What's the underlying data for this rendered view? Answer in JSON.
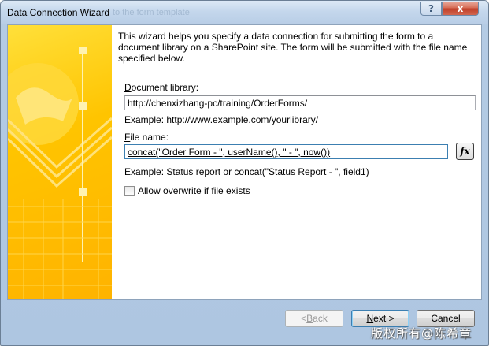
{
  "window": {
    "title": "Data Connection Wizard",
    "title_ghost": "to the form template",
    "help_label": "?",
    "close_label": "x"
  },
  "wizard": {
    "intro": "This wizard helps you specify a data connection for submitting the form to a document library on a SharePoint site. The form will be submitted with the file name specified below.",
    "library": {
      "label_access": "D",
      "label_rest": "ocument library:",
      "value": "http://chenxizhang-pc/training/OrderForms/",
      "example": "Example: http://www.example.com/yourlibrary/"
    },
    "filename": {
      "label_access": "F",
      "label_rest": "ile name:",
      "value": "concat(\"Order Form - \", userName(), \" - \", now())",
      "example": "Example: Status report or concat(\"Status Report - \", field1)",
      "function_button": "fx"
    },
    "overwrite": {
      "label_pre": "Allow ",
      "label_access": "o",
      "label_post": "verwrite if file exists",
      "checked": false
    }
  },
  "buttons": {
    "back_prefix": "< ",
    "back_access": "B",
    "back_rest": "ack",
    "next_access": "N",
    "next_rest": "ext >",
    "cancel": "Cancel"
  },
  "watermark": "版权所有@陈希章",
  "colors": {
    "art_yellow": "#ffc400",
    "frame_blue": "#b4cbe4",
    "close_red": "#c0402a"
  }
}
